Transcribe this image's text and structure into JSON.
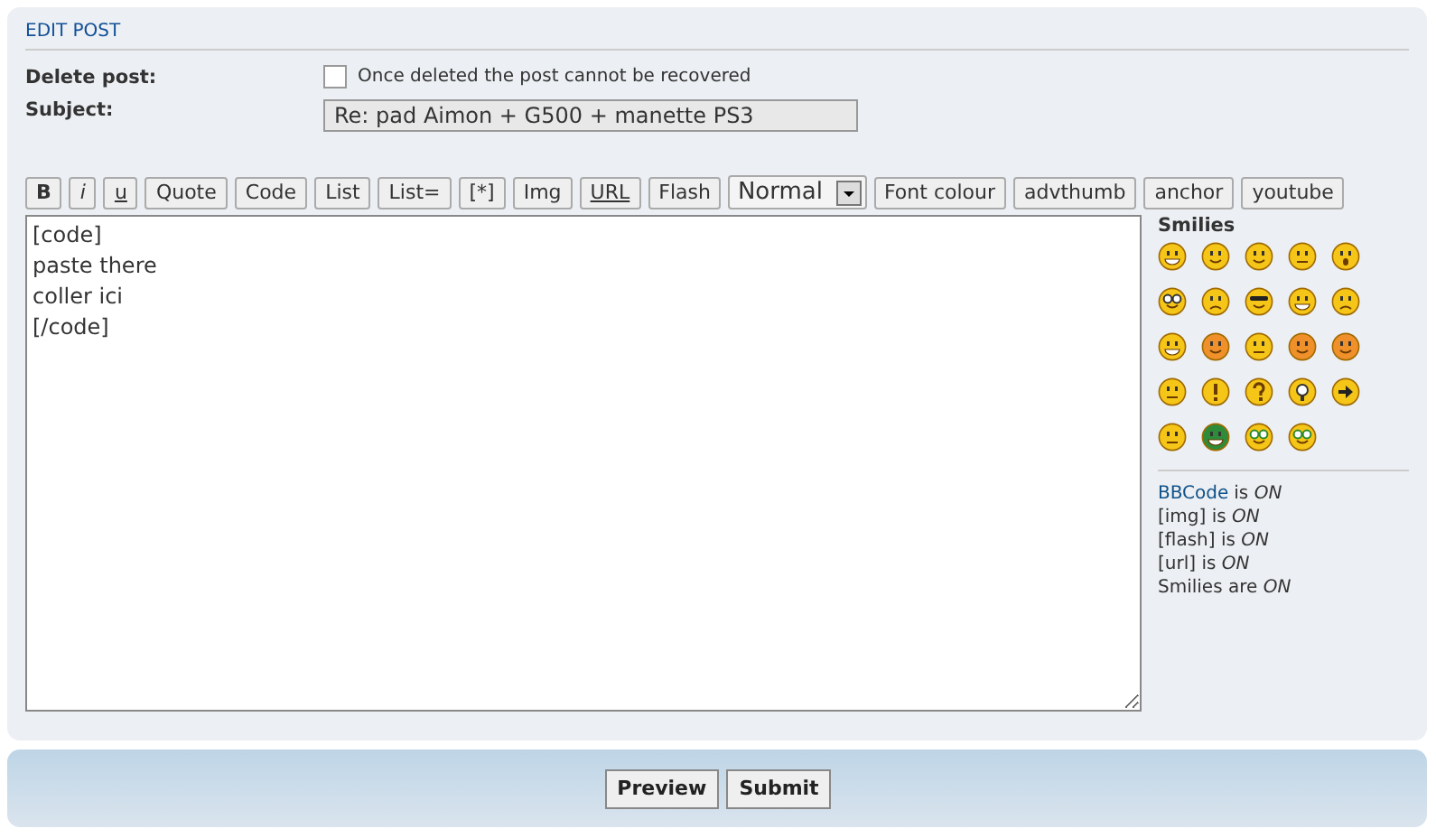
{
  "panel": {
    "title": "EDIT POST"
  },
  "delete_post": {
    "label": "Delete post:",
    "checked": false,
    "note": "Once deleted the post cannot be recovered"
  },
  "subject": {
    "label": "Subject:",
    "value": "Re: pad Aimon + G500 + manette PS3"
  },
  "toolbar": [
    {
      "label": "B",
      "kind": "bold"
    },
    {
      "label": "i",
      "kind": "italic"
    },
    {
      "label": "u",
      "kind": "underline"
    },
    {
      "label": "Quote",
      "kind": "plain"
    },
    {
      "label": "Code",
      "kind": "plain"
    },
    {
      "label": "List",
      "kind": "plain"
    },
    {
      "label": "List=",
      "kind": "plain"
    },
    {
      "label": "[*]",
      "kind": "plain"
    },
    {
      "label": "Img",
      "kind": "plain"
    },
    {
      "label": "URL",
      "kind": "underline"
    },
    {
      "label": "Flash",
      "kind": "plain"
    },
    {
      "label": "Normal",
      "kind": "select"
    },
    {
      "label": "Font colour",
      "kind": "plain"
    },
    {
      "label": "advthumb",
      "kind": "plain"
    },
    {
      "label": "anchor",
      "kind": "plain"
    },
    {
      "label": "youtube",
      "kind": "plain"
    }
  ],
  "message": {
    "value": "[code]\npaste there\ncoller ici\n[/code]"
  },
  "smilies": {
    "title": "Smilies"
  },
  "status": [
    {
      "link": "BBCode",
      "text": "is *ON*"
    },
    {
      "text": "[img] is *ON*"
    },
    {
      "text": "[flash] is *ON*"
    },
    {
      "text": "[url] is *ON*"
    },
    {
      "text": "Smilies are *ON*"
    }
  ],
  "buttons": [
    "Preview",
    "Submit"
  ]
}
